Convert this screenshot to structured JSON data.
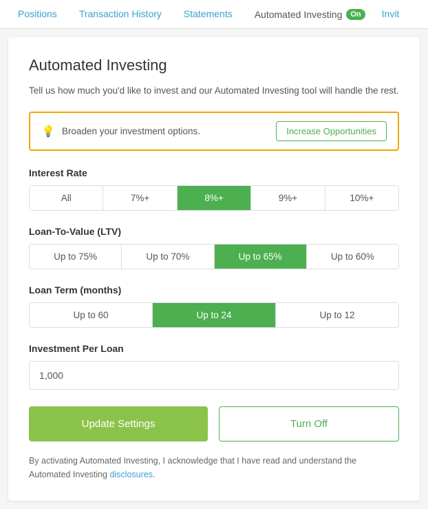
{
  "tabs": [
    {
      "id": "positions",
      "label": "Positions",
      "active": false
    },
    {
      "id": "transaction-history",
      "label": "Transaction History",
      "active": false
    },
    {
      "id": "statements",
      "label": "Statements",
      "active": false
    },
    {
      "id": "automated-investing",
      "label": "Automated Investing",
      "active": true,
      "badge": "On"
    },
    {
      "id": "invite",
      "label": "Invit",
      "active": false
    }
  ],
  "page": {
    "title": "Automated Investing",
    "description": "Tell us how much you'd like to invest and our Automated Investing tool will handle the rest."
  },
  "promo": {
    "icon": "💡",
    "text": "Broaden your investment options.",
    "button_label": "Increase Opportunities"
  },
  "interest_rate": {
    "label": "Interest Rate",
    "options": [
      {
        "id": "all",
        "label": "All",
        "selected": false
      },
      {
        "id": "7pct",
        "label": "7%+",
        "selected": false
      },
      {
        "id": "8pct",
        "label": "8%+",
        "selected": true
      },
      {
        "id": "9pct",
        "label": "9%+",
        "selected": false
      },
      {
        "id": "10pct",
        "label": "10%+",
        "selected": false
      }
    ]
  },
  "ltv": {
    "label": "Loan-To-Value (LTV)",
    "options": [
      {
        "id": "75",
        "label": "Up to 75%",
        "selected": false
      },
      {
        "id": "70",
        "label": "Up to 70%",
        "selected": false
      },
      {
        "id": "65",
        "label": "Up to 65%",
        "selected": true
      },
      {
        "id": "60",
        "label": "Up to 60%",
        "selected": false
      }
    ]
  },
  "loan_term": {
    "label": "Loan Term (months)",
    "options": [
      {
        "id": "60",
        "label": "Up to 60",
        "selected": false
      },
      {
        "id": "24",
        "label": "Up to 24",
        "selected": true
      },
      {
        "id": "12",
        "label": "Up to 12",
        "selected": false
      }
    ]
  },
  "investment_per_loan": {
    "label": "Investment Per Loan",
    "value": "1,000",
    "placeholder": "1,000"
  },
  "buttons": {
    "update": "Update Settings",
    "turnoff": "Turn Off"
  },
  "footer": {
    "text_before_link": "By activating Automated Investing, I acknowledge that I have read and understand the Automated Investing ",
    "link_text": "disclosures",
    "text_after_link": "."
  }
}
